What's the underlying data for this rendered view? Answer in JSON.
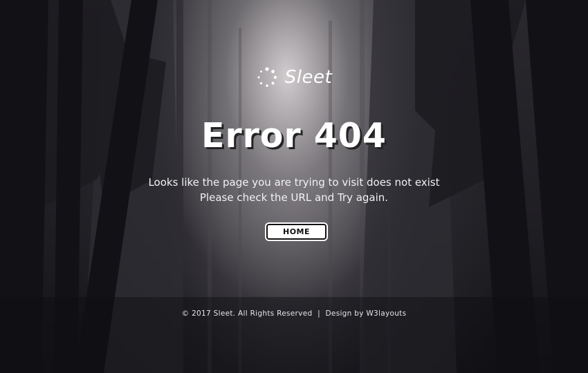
{
  "brand": {
    "logo_text": "Sleet",
    "icon": "dotted-circle-spinner-icon"
  },
  "error": {
    "title": "Error 404",
    "message_line1": "Looks like the page you are trying to visit does not exist",
    "message_line2": "Please check the URL and Try again."
  },
  "actions": {
    "home_label": "HOME"
  },
  "footer": {
    "copyright": "© 2017 Sleet. All Rights Reserved",
    "separator": "|",
    "credit": "Design by W3layouts"
  },
  "colors": {
    "text": "#ffffff",
    "button_bg": "#ffffff",
    "button_text": "#111111",
    "background_dark": "#15151a",
    "fog": "#d8d4d6"
  }
}
